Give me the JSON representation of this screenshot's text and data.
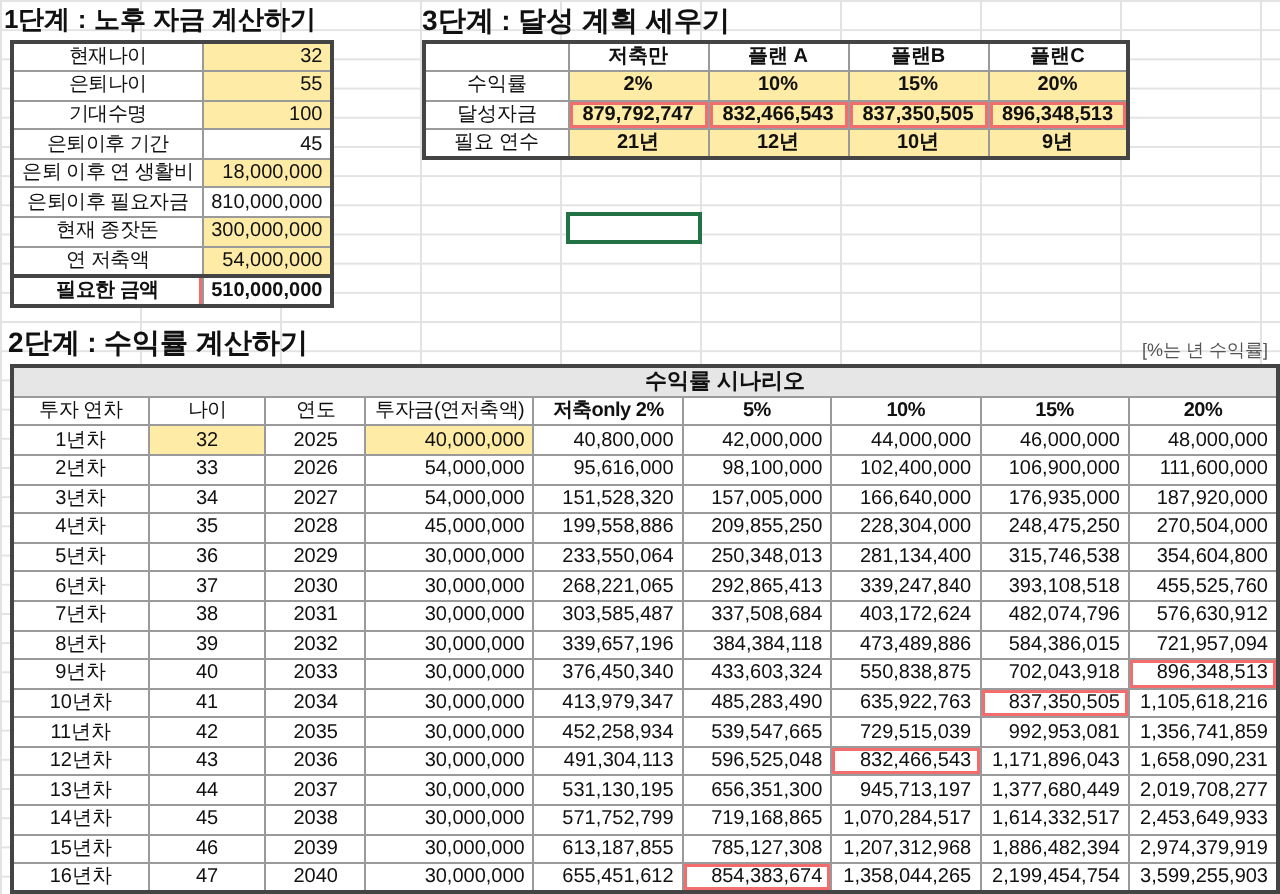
{
  "step1": {
    "title": "1단계 : 노후 자금 계산하기",
    "rows": [
      {
        "label": "현재나이",
        "value": "32",
        "kind": "input"
      },
      {
        "label": "은퇴나이",
        "value": "55",
        "kind": "input"
      },
      {
        "label": "기대수명",
        "value": "100",
        "kind": "input"
      },
      {
        "label": "은퇴이후 기간",
        "value": "45",
        "kind": "calc"
      },
      {
        "label": "은퇴 이후 연 생활비",
        "value": "18,000,000",
        "kind": "input"
      },
      {
        "label": "은퇴이후 필요자금",
        "value": "810,000,000",
        "kind": "calc"
      },
      {
        "label": "현재 종잣돈",
        "value": "300,000,000",
        "kind": "input"
      },
      {
        "label": "연 저축액",
        "value": "54,000,000",
        "kind": "input"
      },
      {
        "label": "필요한 금액",
        "value": "510,000,000",
        "kind": "total"
      }
    ]
  },
  "step3": {
    "title": "3단계 : 달성 계획 세우기",
    "columns": [
      "저축만",
      "플랜 A",
      "플랜B",
      "플랜C"
    ],
    "rows": [
      {
        "label": "수익률",
        "values": [
          "2%",
          "10%",
          "15%",
          "20%"
        ],
        "kind": "result"
      },
      {
        "label": "달성자금",
        "values": [
          "879,792,747",
          "832,466,543",
          "837,350,505",
          "896,348,513"
        ],
        "kind": "target"
      },
      {
        "label": "필요 연수",
        "values": [
          "21년",
          "12년",
          "10년",
          "9년"
        ],
        "kind": "result"
      }
    ]
  },
  "active_cell": {
    "selected": true
  },
  "step2": {
    "title": "2단계 : 수익률 계산하기",
    "note": "[%는 년 수익률]",
    "group_header": "수익률 시나리오",
    "columns": [
      "투자 연차",
      "나이",
      "연도",
      "투자금(연저축액)",
      "저축only 2%",
      "5%",
      "10%",
      "15%",
      "20%"
    ],
    "rows": [
      {
        "term": "1년차",
        "age": "32",
        "year": "2025",
        "investment": "40,000,000",
        "input": true,
        "returns": [
          "40,800,000",
          "42,000,000",
          "44,000,000",
          "46,000,000",
          "48,000,000"
        ],
        "targets": [
          false,
          false,
          false,
          false,
          false
        ]
      },
      {
        "term": "2년차",
        "age": "33",
        "year": "2026",
        "investment": "54,000,000",
        "input": false,
        "returns": [
          "95,616,000",
          "98,100,000",
          "102,400,000",
          "106,900,000",
          "111,600,000"
        ],
        "targets": [
          false,
          false,
          false,
          false,
          false
        ]
      },
      {
        "term": "3년차",
        "age": "34",
        "year": "2027",
        "investment": "54,000,000",
        "input": false,
        "returns": [
          "151,528,320",
          "157,005,000",
          "166,640,000",
          "176,935,000",
          "187,920,000"
        ],
        "targets": [
          false,
          false,
          false,
          false,
          false
        ]
      },
      {
        "term": "4년차",
        "age": "35",
        "year": "2028",
        "investment": "45,000,000",
        "input": false,
        "returns": [
          "199,558,886",
          "209,855,250",
          "228,304,000",
          "248,475,250",
          "270,504,000"
        ],
        "targets": [
          false,
          false,
          false,
          false,
          false
        ]
      },
      {
        "term": "5년차",
        "age": "36",
        "year": "2029",
        "investment": "30,000,000",
        "input": false,
        "returns": [
          "233,550,064",
          "250,348,013",
          "281,134,400",
          "315,746,538",
          "354,604,800"
        ],
        "targets": [
          false,
          false,
          false,
          false,
          false
        ]
      },
      {
        "term": "6년차",
        "age": "37",
        "year": "2030",
        "investment": "30,000,000",
        "input": false,
        "returns": [
          "268,221,065",
          "292,865,413",
          "339,247,840",
          "393,108,518",
          "455,525,760"
        ],
        "targets": [
          false,
          false,
          false,
          false,
          false
        ]
      },
      {
        "term": "7년차",
        "age": "38",
        "year": "2031",
        "investment": "30,000,000",
        "input": false,
        "returns": [
          "303,585,487",
          "337,508,684",
          "403,172,624",
          "482,074,796",
          "576,630,912"
        ],
        "targets": [
          false,
          false,
          false,
          false,
          false
        ]
      },
      {
        "term": "8년차",
        "age": "39",
        "year": "2032",
        "investment": "30,000,000",
        "input": false,
        "returns": [
          "339,657,196",
          "384,384,118",
          "473,489,886",
          "584,386,015",
          "721,957,094"
        ],
        "targets": [
          false,
          false,
          false,
          false,
          false
        ]
      },
      {
        "term": "9년차",
        "age": "40",
        "year": "2033",
        "investment": "30,000,000",
        "input": false,
        "returns": [
          "376,450,340",
          "433,603,324",
          "550,838,875",
          "702,043,918",
          "896,348,513"
        ],
        "targets": [
          false,
          false,
          false,
          false,
          true
        ]
      },
      {
        "term": "10년차",
        "age": "41",
        "year": "2034",
        "investment": "30,000,000",
        "input": false,
        "returns": [
          "413,979,347",
          "485,283,490",
          "635,922,763",
          "837,350,505",
          "1,105,618,216"
        ],
        "targets": [
          false,
          false,
          false,
          true,
          false
        ]
      },
      {
        "term": "11년차",
        "age": "42",
        "year": "2035",
        "investment": "30,000,000",
        "input": false,
        "returns": [
          "452,258,934",
          "539,547,665",
          "729,515,039",
          "992,953,081",
          "1,356,741,859"
        ],
        "targets": [
          false,
          false,
          false,
          false,
          false
        ]
      },
      {
        "term": "12년차",
        "age": "43",
        "year": "2036",
        "investment": "30,000,000",
        "input": false,
        "returns": [
          "491,304,113",
          "596,525,048",
          "832,466,543",
          "1,171,896,043",
          "1,658,090,231"
        ],
        "targets": [
          false,
          false,
          true,
          false,
          false
        ]
      },
      {
        "term": "13년차",
        "age": "44",
        "year": "2037",
        "investment": "30,000,000",
        "input": false,
        "returns": [
          "531,130,195",
          "656,351,300",
          "945,713,197",
          "1,377,680,449",
          "2,019,708,277"
        ],
        "targets": [
          false,
          false,
          false,
          false,
          false
        ]
      },
      {
        "term": "14년차",
        "age": "45",
        "year": "2038",
        "investment": "30,000,000",
        "input": false,
        "returns": [
          "571,752,799",
          "719,168,865",
          "1,070,284,517",
          "1,614,332,517",
          "2,453,649,933"
        ],
        "targets": [
          false,
          false,
          false,
          false,
          false
        ]
      },
      {
        "term": "15년차",
        "age": "46",
        "year": "2039",
        "investment": "30,000,000",
        "input": false,
        "returns": [
          "613,187,855",
          "785,127,308",
          "1,207,312,968",
          "1,886,482,394",
          "2,974,379,919"
        ],
        "targets": [
          false,
          false,
          false,
          false,
          false
        ]
      },
      {
        "term": "16년차",
        "age": "47",
        "year": "2040",
        "investment": "30,000,000",
        "input": false,
        "returns": [
          "655,451,612",
          "854,383,674",
          "1,358,044,265",
          "2,199,454,754",
          "3,599,255,903"
        ],
        "targets": [
          false,
          true,
          false,
          false,
          false
        ]
      }
    ]
  }
}
